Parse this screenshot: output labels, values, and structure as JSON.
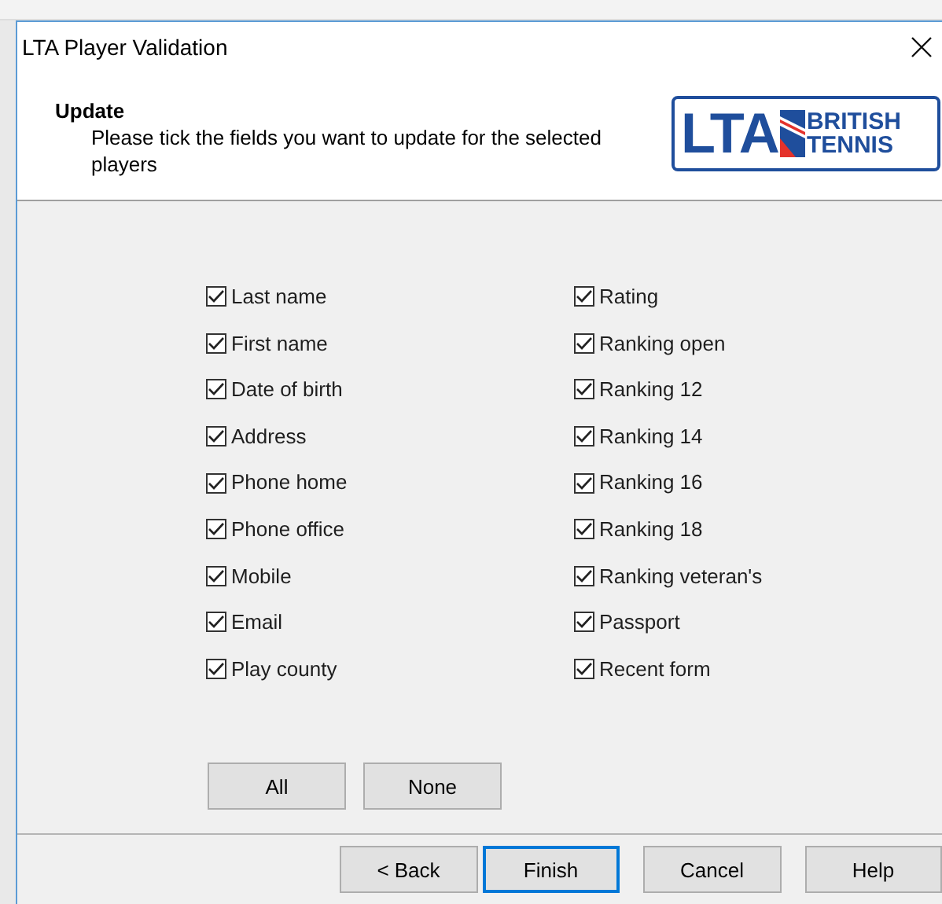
{
  "window": {
    "title": "LTA Player Validation"
  },
  "header": {
    "title": "Update",
    "description": "Please tick the fields you want to update for the selected players",
    "logo": {
      "mark": "LTA",
      "line_1": "BRITISH",
      "line_2": "TENNIS"
    }
  },
  "field_columns": [
    {
      "fields": [
        {
          "label": "Last name",
          "checked": true
        },
        {
          "label": "First name",
          "checked": true
        },
        {
          "label": "Date of birth",
          "checked": true
        },
        {
          "label": "Address",
          "checked": true
        },
        {
          "label": "Phone home",
          "checked": true
        },
        {
          "label": "Phone office",
          "checked": true
        },
        {
          "label": "Mobile",
          "checked": true
        },
        {
          "label": "Email",
          "checked": true
        },
        {
          "label": "Play county",
          "checked": true
        }
      ]
    },
    {
      "fields": [
        {
          "label": "Rating",
          "checked": true
        },
        {
          "label": "Ranking open",
          "checked": true
        },
        {
          "label": "Ranking 12",
          "checked": true
        },
        {
          "label": "Ranking 14",
          "checked": true
        },
        {
          "label": "Ranking 16",
          "checked": true
        },
        {
          "label": "Ranking 18",
          "checked": true
        },
        {
          "label": "Ranking veteran's",
          "checked": true
        },
        {
          "label": "Passport",
          "checked": true
        },
        {
          "label": "Recent form",
          "checked": true
        }
      ]
    }
  ],
  "select_buttons": [
    "All",
    "None"
  ],
  "footer_buttons": [
    {
      "label": "< Back",
      "default": false
    },
    {
      "label": "Finish",
      "default": true
    },
    {
      "label": "Cancel",
      "default": false
    },
    {
      "label": "Help",
      "default": false
    }
  ]
}
